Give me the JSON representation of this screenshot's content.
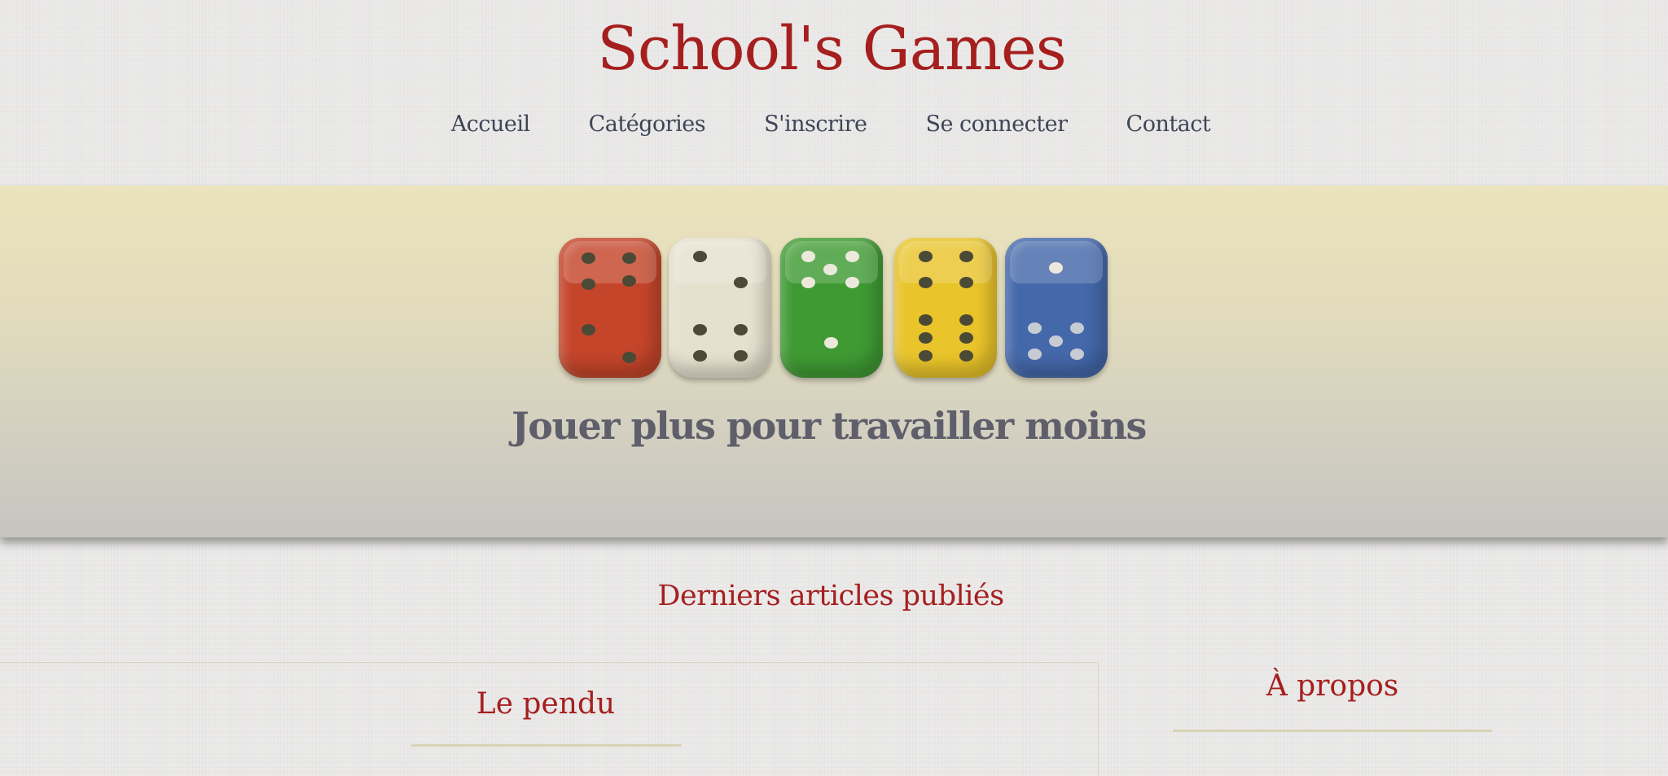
{
  "header": {
    "site_title": "School's Games",
    "nav": [
      {
        "label": "Accueil"
      },
      {
        "label": "Catégories"
      },
      {
        "label": "S'inscrire"
      },
      {
        "label": "Se connecter"
      },
      {
        "label": "Contact"
      }
    ]
  },
  "hero": {
    "image": "colored-dice-image",
    "dice_colors": [
      "#c4452a",
      "#e6e1cf",
      "#3f9a33",
      "#e9c42a",
      "#4468aa"
    ],
    "tagline": "Jouer plus pour travailler moins"
  },
  "main": {
    "section_title": "Derniers articles publiés",
    "articles": [
      {
        "title": "Le pendu"
      }
    ]
  },
  "sidebar": {
    "about_title": "À propos"
  },
  "colors": {
    "accent": "#a51f1f",
    "nav_text": "#3f4556",
    "tagline_text": "#5e5f6a",
    "page_background": "#ecebea"
  }
}
